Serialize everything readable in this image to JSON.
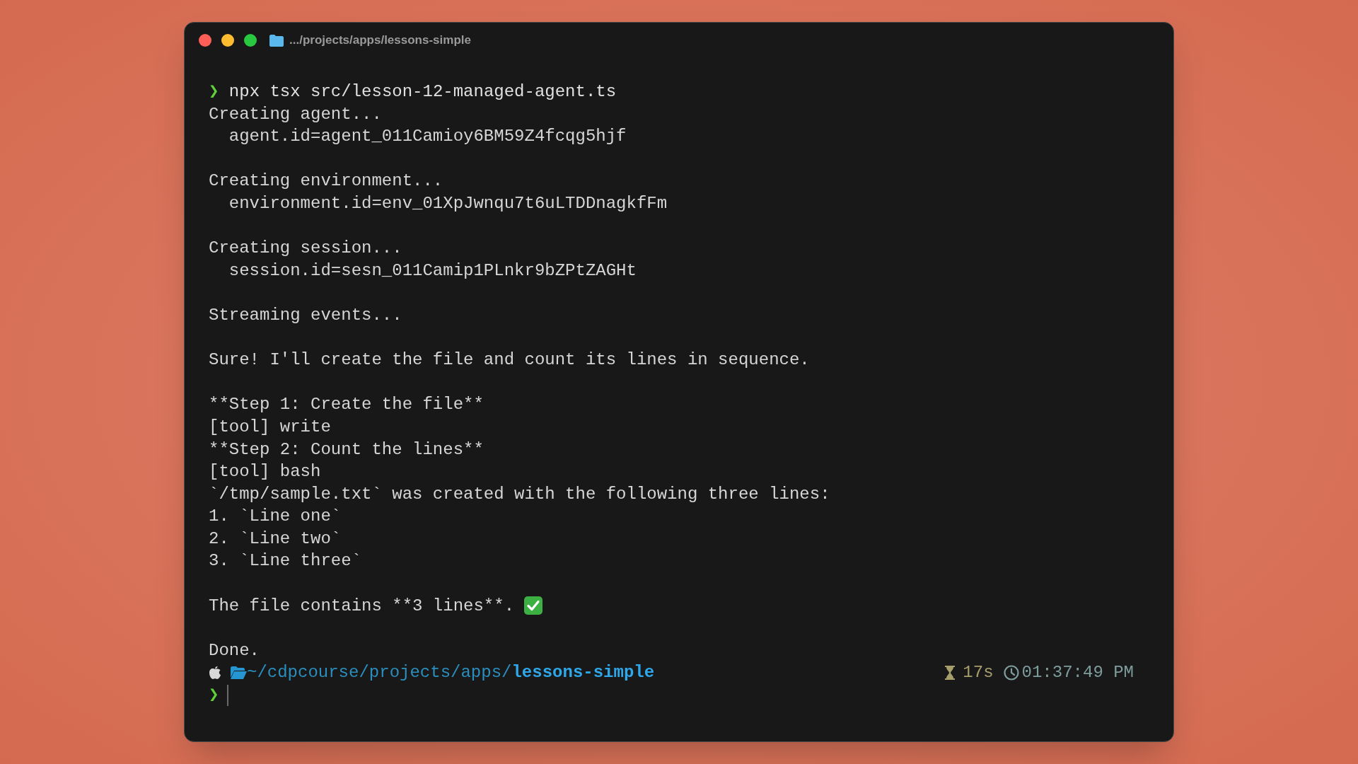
{
  "window": {
    "title": ".../projects/apps/lessons-simple"
  },
  "terminal": {
    "lines": [
      {
        "kind": "command",
        "prompt": "❯",
        "text": "npx tsx src/lesson-12-managed-agent.ts"
      },
      {
        "kind": "output",
        "text": "Creating agent..."
      },
      {
        "kind": "output",
        "text": "  agent.id=agent_011Camioy6BM59Z4fcqg5hjf"
      },
      {
        "kind": "blank"
      },
      {
        "kind": "output",
        "text": "Creating environment..."
      },
      {
        "kind": "output",
        "text": "  environment.id=env_01XpJwnqu7t6uLTDDnagkfFm"
      },
      {
        "kind": "blank"
      },
      {
        "kind": "output",
        "text": "Creating session..."
      },
      {
        "kind": "output",
        "text": "  session.id=sesn_011Camip1PLnkr9bZPtZAGHt"
      },
      {
        "kind": "blank"
      },
      {
        "kind": "output",
        "text": "Streaming events..."
      },
      {
        "kind": "blank"
      },
      {
        "kind": "output",
        "text": "Sure! I'll create the file and count its lines in sequence."
      },
      {
        "kind": "blank"
      },
      {
        "kind": "output",
        "text": "**Step 1: Create the file**"
      },
      {
        "kind": "output",
        "text": "[tool] write"
      },
      {
        "kind": "output",
        "text": "**Step 2: Count the lines**"
      },
      {
        "kind": "output",
        "text": "[tool] bash"
      },
      {
        "kind": "output",
        "text": "`/tmp/sample.txt` was created with the following three lines:"
      },
      {
        "kind": "output",
        "text": "1. `Line one`"
      },
      {
        "kind": "output",
        "text": "2. `Line two`"
      },
      {
        "kind": "output",
        "text": "3. `Line three`"
      },
      {
        "kind": "blank"
      },
      {
        "kind": "output",
        "text": "The file contains **3 lines**.",
        "check": true
      },
      {
        "kind": "blank"
      },
      {
        "kind": "output",
        "text": "Done."
      },
      {
        "kind": "prompt_info",
        "path": "~/cdpcourse/projects/apps/",
        "folder": "lessons-simple",
        "duration": "17s",
        "time": "01:37:49 PM"
      },
      {
        "kind": "input",
        "prompt": "❯",
        "cursor": true
      }
    ]
  }
}
